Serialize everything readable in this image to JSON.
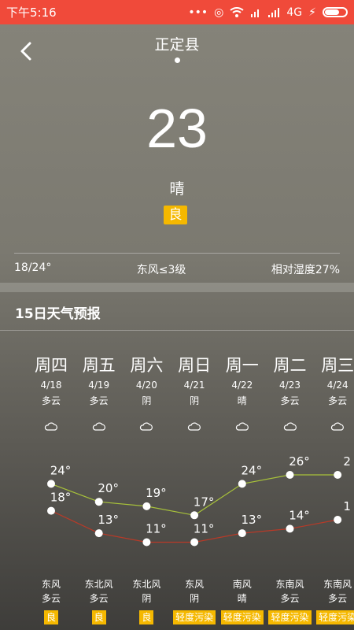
{
  "status": {
    "time": "下午5:16",
    "icons": [
      "dots-icon",
      "alarm-icon",
      "wifi-icon",
      "signal-icon",
      "signal-icon"
    ],
    "network": "4G"
  },
  "header": {
    "city": "正定县"
  },
  "current": {
    "temp": "23",
    "condition": "晴",
    "aqi": "良",
    "range": "18/24°",
    "wind": "东风≤3级",
    "humidity": "相对湿度27%"
  },
  "forecast": {
    "title": "15日天气预报",
    "days": [
      {
        "wk": "周四",
        "date": "4/18",
        "wx": "多云",
        "high": "24°",
        "low": "18°",
        "wind": "东风",
        "nwx": "多云",
        "aq": "良"
      },
      {
        "wk": "周五",
        "date": "4/19",
        "wx": "多云",
        "high": "20°",
        "low": "13°",
        "wind": "东北风",
        "nwx": "多云",
        "aq": "良"
      },
      {
        "wk": "周六",
        "date": "4/20",
        "wx": "阴",
        "high": "19°",
        "low": "11°",
        "wind": "东北风",
        "nwx": "阴",
        "aq": "良"
      },
      {
        "wk": "周日",
        "date": "4/21",
        "wx": "阴",
        "high": "17°",
        "low": "11°",
        "wind": "东风",
        "nwx": "阴",
        "aq": "轻度污染"
      },
      {
        "wk": "周一",
        "date": "4/22",
        "wx": "晴",
        "high": "24°",
        "low": "13°",
        "wind": "南风",
        "nwx": "晴",
        "aq": "轻度污染"
      },
      {
        "wk": "周二",
        "date": "4/23",
        "wx": "多云",
        "high": "26°",
        "low": "14°",
        "wind": "东南风",
        "nwx": "多云",
        "aq": "轻度污染"
      },
      {
        "wk": "周三",
        "date": "4/24",
        "wx": "多云",
        "high": "2",
        "low": "1",
        "wind": "东南风",
        "nwx": "多云",
        "aq": "轻度污染"
      }
    ]
  },
  "chart_data": {
    "type": "line",
    "categories": [
      "周四",
      "周五",
      "周六",
      "周日",
      "周一",
      "周二",
      "周三"
    ],
    "series": [
      {
        "values": [
          24,
          20,
          19,
          17,
          24,
          26,
          26
        ],
        "color": "#a8c23a"
      },
      {
        "values": [
          18,
          13,
          11,
          11,
          13,
          14,
          16
        ],
        "color": "#b83a28"
      }
    ]
  },
  "colors": {
    "accent": "#f5b800",
    "statusbar": "#f04a3a"
  }
}
